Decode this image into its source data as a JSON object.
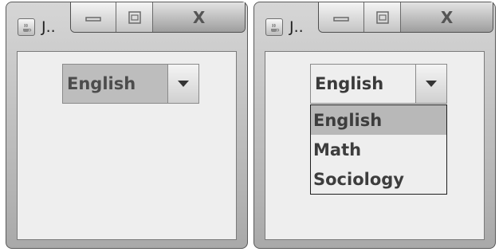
{
  "windows": [
    {
      "title": "J..",
      "close_label": "X",
      "combo": {
        "selected": "English",
        "expanded": false
      }
    },
    {
      "title": "J..",
      "close_label": "X",
      "combo": {
        "selected": "English",
        "expanded": true,
        "options": [
          "English",
          "Math",
          "Sociology"
        ],
        "highlighted_index": 0
      }
    }
  ],
  "colors": {
    "client_background": "#eeeeee",
    "highlight": "#b8b8b8",
    "text": "#3d3d3d"
  },
  "icons": [
    "java-coffee-icon",
    "minimize-icon",
    "maximize-icon",
    "close-icon",
    "dropdown-arrow-icon"
  ]
}
